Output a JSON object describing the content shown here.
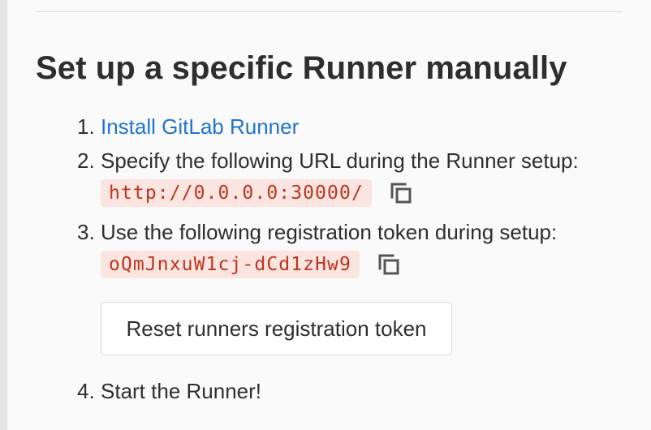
{
  "section": {
    "title": "Set up a specific Runner manually"
  },
  "steps": [
    {
      "number": "1.",
      "link_text": "Install GitLab Runner"
    },
    {
      "number": "2.",
      "text": "Specify the following URL during the Runner setup:",
      "code": "http://0.0.0.0:30000/"
    },
    {
      "number": "3.",
      "text": "Use the following registration token during setup:",
      "code": "oQmJnxuW1cj-dCd1zHw9",
      "button_label": "Reset runners registration token"
    },
    {
      "number": "4.",
      "text": "Start the Runner!"
    }
  ],
  "icons": {
    "copy": "copy-icon"
  },
  "colors": {
    "link": "#1f75cb",
    "code_text": "#c0341d",
    "code_background": "#fbe5e1",
    "text": "#2e2e2e"
  }
}
